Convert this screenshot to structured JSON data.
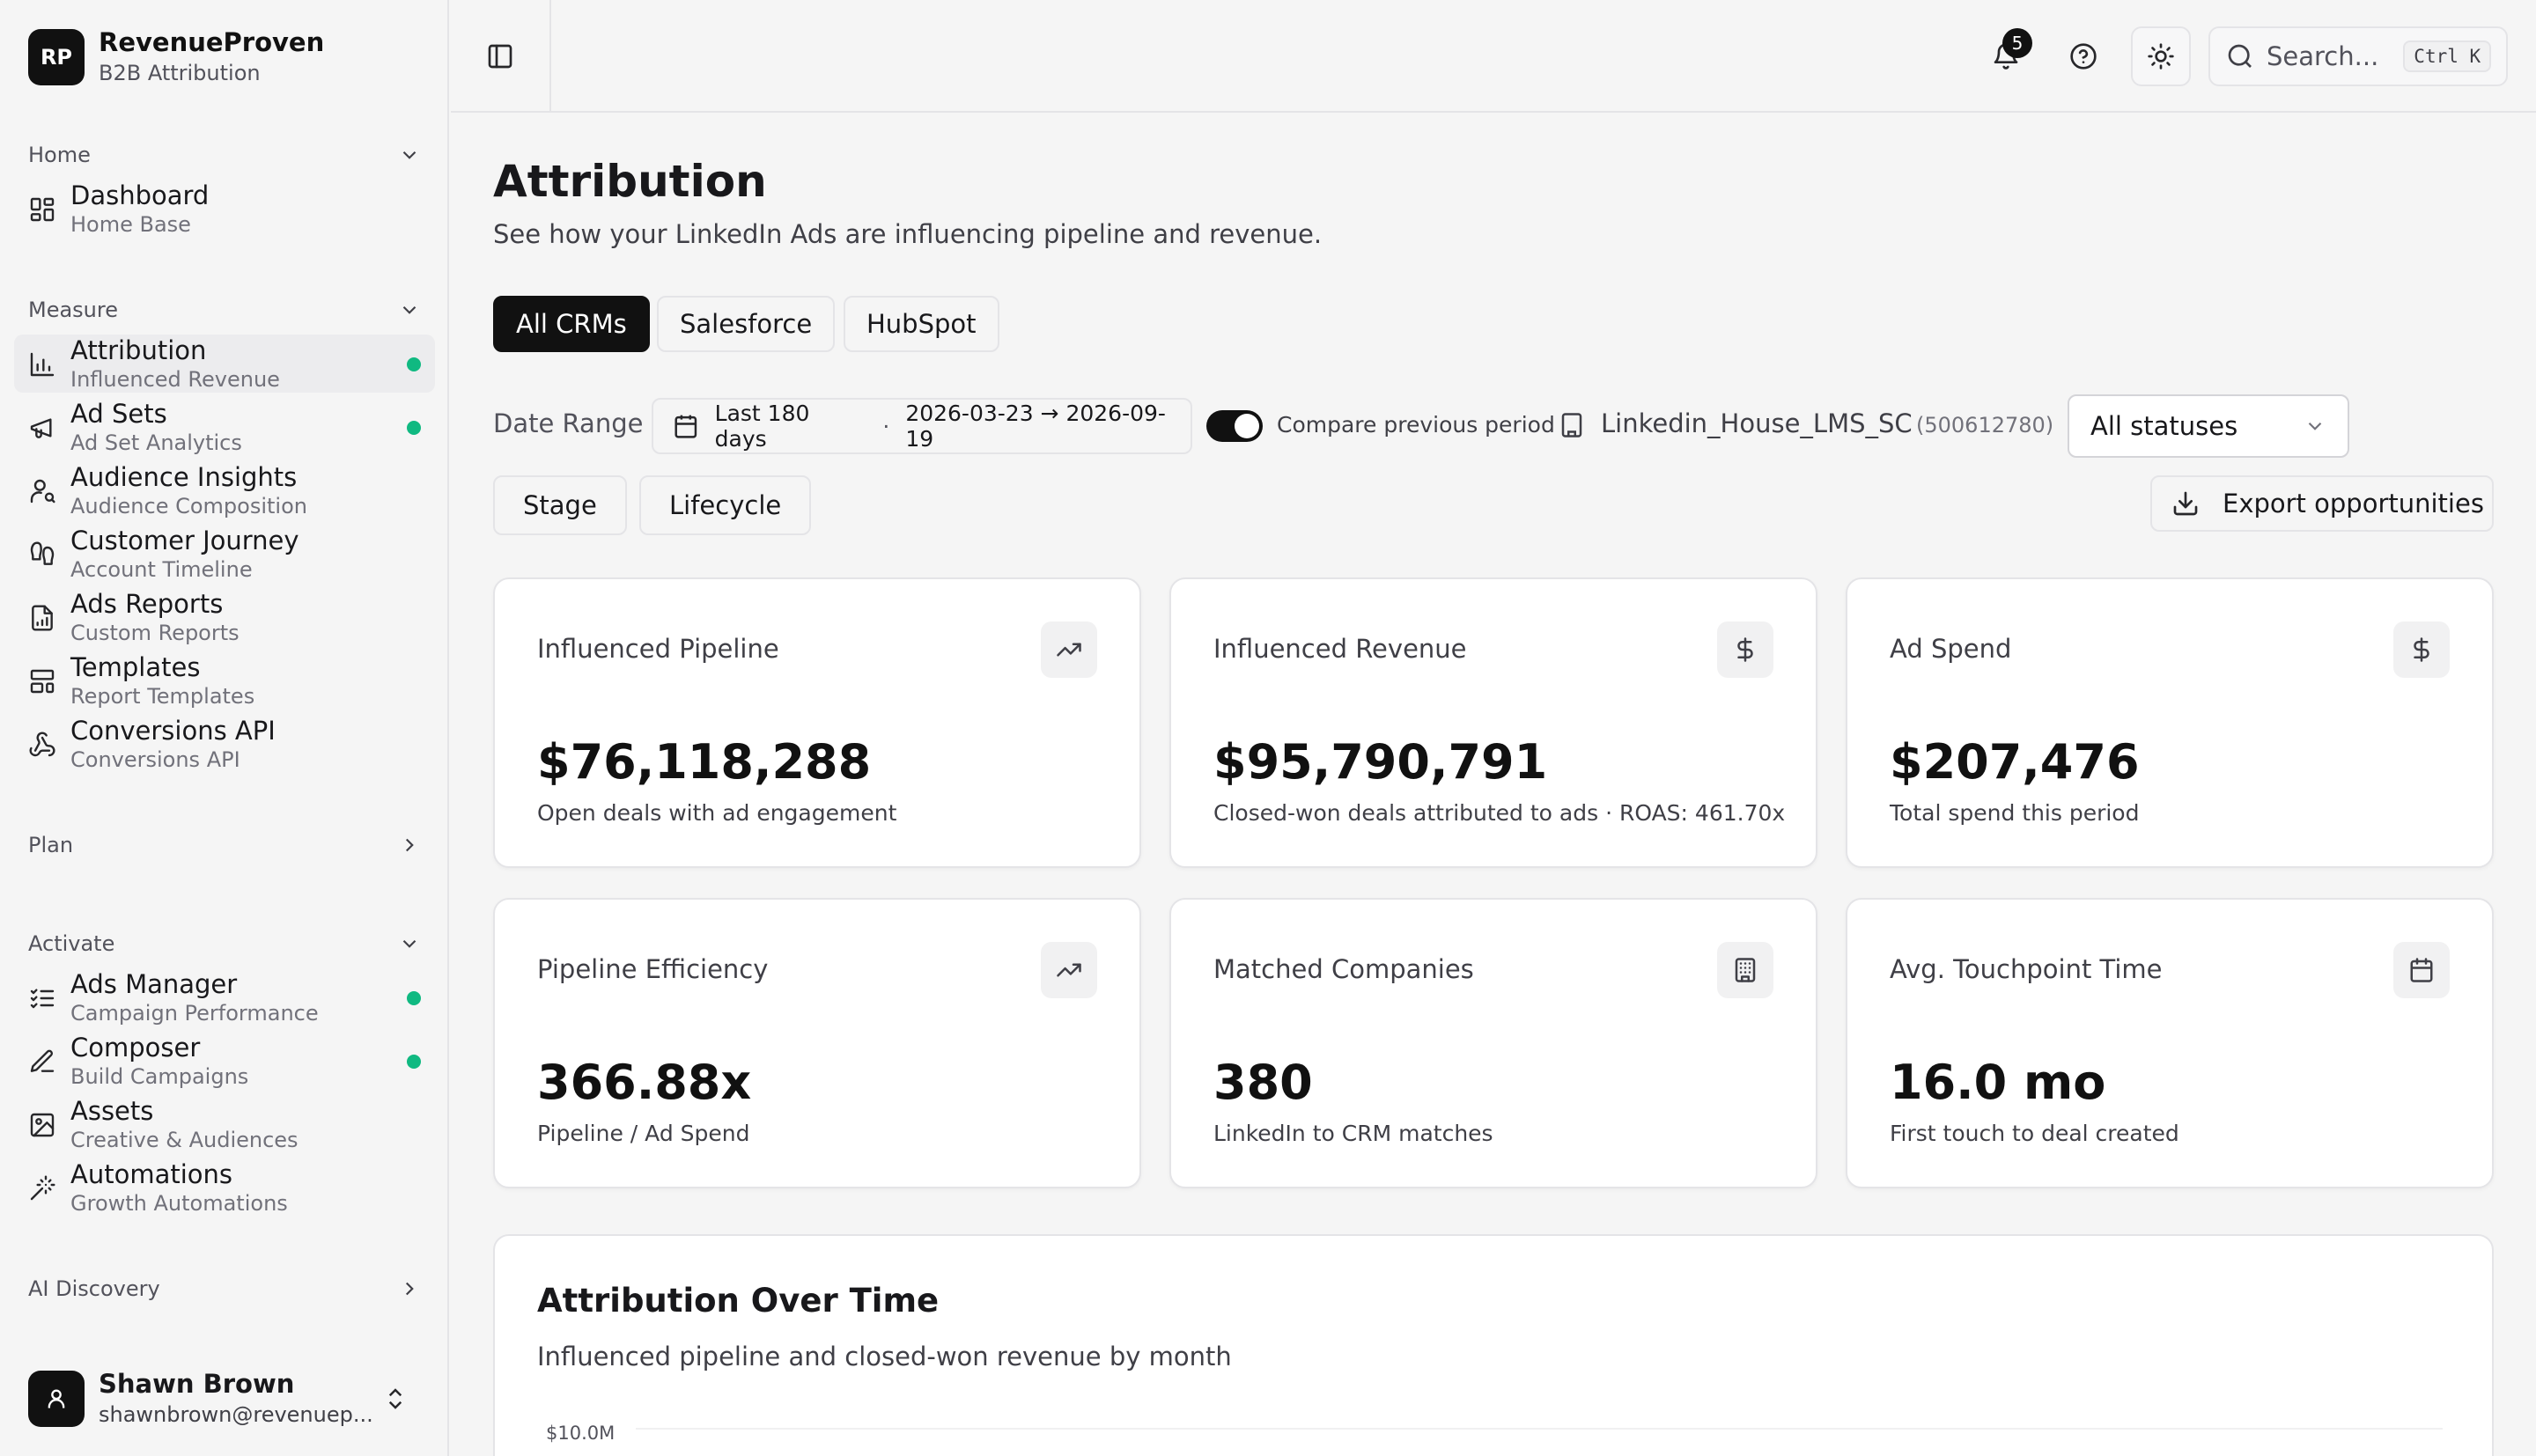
{
  "brand": {
    "logo": "RP",
    "name": "RevenueProven",
    "subtitle": "B2B Attribution"
  },
  "sidebar": {
    "groups": {
      "home": "Home",
      "measure": "Measure",
      "plan": "Plan",
      "activate": "Activate",
      "ai_discovery": "AI Discovery"
    },
    "home_items": [
      {
        "label": "Dashboard",
        "sub": "Home Base",
        "icon": "grid-icon"
      }
    ],
    "measure_items": [
      {
        "label": "Attribution",
        "sub": "Influenced Revenue",
        "icon": "bar-chart-icon",
        "active": true,
        "status_dot": true
      },
      {
        "label": "Ad Sets",
        "sub": "Ad Set Analytics",
        "icon": "megaphone-icon",
        "status_dot": true
      },
      {
        "label": "Audience Insights",
        "sub": "Audience Composition",
        "icon": "user-search-icon"
      },
      {
        "label": "Customer Journey",
        "sub": "Account Timeline",
        "icon": "footprints-icon"
      },
      {
        "label": "Ads Reports",
        "sub": "Custom Reports",
        "icon": "file-chart-icon"
      },
      {
        "label": "Templates",
        "sub": "Report Templates",
        "icon": "layout-template-icon"
      },
      {
        "label": "Conversions API",
        "sub": "Conversions API",
        "icon": "webhook-icon"
      }
    ],
    "activate_items": [
      {
        "label": "Ads Manager",
        "sub": "Campaign Performance",
        "icon": "list-checks-icon",
        "status_dot": true
      },
      {
        "label": "Composer",
        "sub": "Build Campaigns",
        "icon": "pen-icon",
        "status_dot": true
      },
      {
        "label": "Assets",
        "sub": "Creative & Audiences",
        "icon": "image-icon"
      },
      {
        "label": "Automations",
        "sub": "Growth Automations",
        "icon": "wand-icon"
      }
    ],
    "user": {
      "name": "Shawn Brown",
      "email": "shawnbrown@revenuep..."
    }
  },
  "topbar": {
    "notifications_count": "5",
    "search_placeholder": "Search...",
    "search_shortcut": "Ctrl K"
  },
  "page": {
    "title": "Attribution",
    "subtitle": "See how your LinkedIn Ads are influencing pipeline and revenue."
  },
  "crm_tabs": [
    "All CRMs",
    "Salesforce",
    "HubSpot"
  ],
  "filters": {
    "date_range_label": "Date Range",
    "date_preset": "Last 180 days",
    "date_separator": "·",
    "date_span": "2026-03-23 → 2026-09-19",
    "compare_label": "Compare previous period",
    "compare_on": true,
    "account_name": "Linkedin_House_LMS_SC",
    "account_id": "(500612780)",
    "status_select": "All statuses",
    "stage_button": "Stage",
    "lifecycle_button": "Lifecycle",
    "export_button": "Export opportunities"
  },
  "kpis": [
    {
      "title": "Influenced Pipeline",
      "value": "$76,118,288",
      "note": "Open deals with ad engagement",
      "icon": "trending-up-icon"
    },
    {
      "title": "Influenced Revenue",
      "value": "$95,790,791",
      "note": "Closed-won deals attributed to ads · ROAS: 461.70x",
      "icon": "dollar-icon"
    },
    {
      "title": "Ad Spend",
      "value": "$207,476",
      "note": "Total spend this period",
      "icon": "dollar-icon"
    },
    {
      "title": "Pipeline Efficiency",
      "value": "366.88x",
      "note": "Pipeline / Ad Spend",
      "icon": "trending-up-icon"
    },
    {
      "title": "Matched Companies",
      "value": "380",
      "note": "LinkedIn to CRM matches",
      "icon": "building-icon"
    },
    {
      "title": "Avg. Touchpoint Time",
      "value": "16.0 mo",
      "note": "First touch to deal created",
      "icon": "calendar-icon"
    }
  ],
  "chart": {
    "title": "Attribution Over Time",
    "subtitle": "Influenced pipeline and closed-won revenue by month",
    "top_tick": "$10.0M"
  },
  "colors": {
    "accent": "#111111",
    "status_dot": "#10b981"
  }
}
